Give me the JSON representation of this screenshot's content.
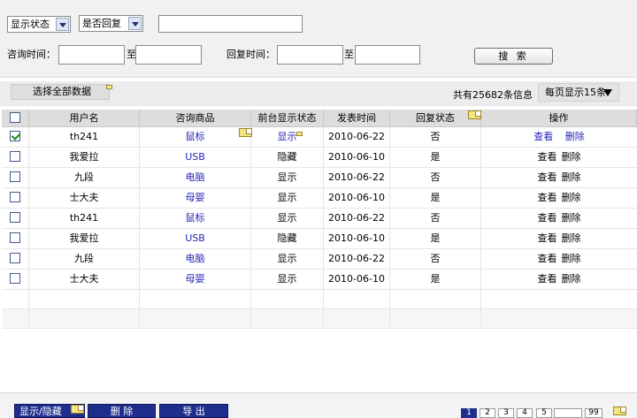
{
  "filters": {
    "status_select": "显示状态",
    "reply_select": "是否回复",
    "keyword_value": "",
    "consult_time_label": "咨询时间：",
    "reply_time_label": "回复时间：",
    "to_label": "至",
    "search_label": "搜 索"
  },
  "toolbar": {
    "select_all_label": "选择全部数据",
    "total_text": "共有25682条信息",
    "per_page_text": "每页显示15条"
  },
  "table": {
    "columns": [
      "用户名",
      "咨询商品",
      "前台显示状态",
      "发表时间",
      "回复状态",
      "操作"
    ],
    "rows": [
      {
        "checked": true,
        "user": "th241",
        "product": "鼠标",
        "display": "显示",
        "date": "2010-06-22",
        "reply": "否",
        "view": "查看",
        "del": "删除"
      },
      {
        "checked": false,
        "user": "我爱拉",
        "product": "USB",
        "display": "隐藏",
        "date": "2010-06-10",
        "reply": "是",
        "view": "查看",
        "del": "删除"
      },
      {
        "checked": false,
        "user": "九段",
        "product": "电脑",
        "display": "显示",
        "date": "2010-06-22",
        "reply": "否",
        "view": "查看",
        "del": "删除"
      },
      {
        "checked": false,
        "user": "士大夫",
        "product": "母婴",
        "display": "显示",
        "date": "2010-06-10",
        "reply": "是",
        "view": "查看",
        "del": "删除"
      },
      {
        "checked": false,
        "user": "th241",
        "product": "鼠标",
        "display": "显示",
        "date": "2010-06-22",
        "reply": "否",
        "view": "查看",
        "del": "删除"
      },
      {
        "checked": false,
        "user": "我爱拉",
        "product": "USB",
        "display": "隐藏",
        "date": "2010-06-10",
        "reply": "是",
        "view": "查看",
        "del": "删除"
      },
      {
        "checked": false,
        "user": "九段",
        "product": "电脑",
        "display": "显示",
        "date": "2010-06-22",
        "reply": "否",
        "view": "查看",
        "del": "删除"
      },
      {
        "checked": false,
        "user": "士大夫",
        "product": "母婴",
        "display": "显示",
        "date": "2010-06-10",
        "reply": "是",
        "view": "查看",
        "del": "删除"
      }
    ]
  },
  "bottom": {
    "toggle_label": "显示/隐藏",
    "delete_label": "删 除",
    "export_label": "导 出"
  },
  "pagination": {
    "pages": [
      "1",
      "2",
      "3",
      "4",
      "5"
    ],
    "current": "1",
    "last": "99"
  },
  "colors": {
    "link": "#2525b8",
    "button_bg": "#1f2e8c",
    "header_bg": "#dddddd"
  }
}
